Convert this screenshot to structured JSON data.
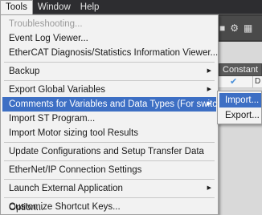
{
  "menubar": {
    "items": [
      {
        "label": "Tools"
      },
      {
        "label": "Window"
      },
      {
        "label": "Help"
      }
    ]
  },
  "toolbar": {
    "icons": [
      "puzzle-icon",
      "gear-icon",
      "grid-icon"
    ]
  },
  "table": {
    "header": "Constant",
    "cell_col2": "D"
  },
  "tools_menu": {
    "items": [
      {
        "label": "Troubleshooting...",
        "enabled": false
      },
      {
        "label": "Event Log Viewer..."
      },
      {
        "label": "EtherCAT Diagnosis/Statistics Information Viewer..."
      },
      {
        "label": "Backup",
        "submenu": true
      },
      {
        "label": "Export Global Variables",
        "submenu": true
      },
      {
        "label": "Comments for Variables and Data Types (For switching)",
        "submenu": true,
        "highlighted": true
      },
      {
        "label": "Import ST Program..."
      },
      {
        "label": "Import Motor sizing tool Results"
      },
      {
        "label": "Update Configurations and Setup Transfer Data"
      },
      {
        "label": "EtherNet/IP Connection Settings"
      },
      {
        "label": "Launch External Application",
        "submenu": true
      },
      {
        "label": "Customize Shortcut Keys..."
      },
      {
        "label": "Option..."
      }
    ]
  },
  "comments_submenu": {
    "items": [
      {
        "label": "Import...",
        "highlighted": true
      },
      {
        "label": "Export..."
      }
    ]
  },
  "colors": {
    "highlight": "#3d6fc4",
    "menu_bg": "#f2f2f2",
    "disabled_text": "#9a9a9a"
  }
}
